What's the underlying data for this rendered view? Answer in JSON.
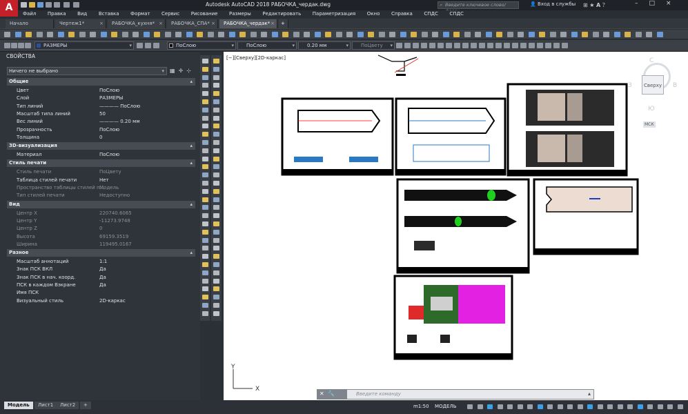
{
  "app": {
    "logo_text": "A",
    "title": "Autodesk AutoCAD 2018    РАБОЧКА_чердак.dwg",
    "search_placeholder": "Введите ключевое слово/фразу",
    "sign_in": "Вход в службы"
  },
  "menu": [
    "Файл",
    "Правка",
    "Вид",
    "Вставка",
    "Формат",
    "Сервис",
    "Рисование",
    "Размеры",
    "Редактировать",
    "Параметризация",
    "Окно",
    "Справка",
    "СПДС",
    "СПДС"
  ],
  "tabs": [
    {
      "label": "Начало",
      "close": ""
    },
    {
      "label": "Чертеж1*",
      "close": "×"
    },
    {
      "label": "РАБОЧКА_кухня*",
      "close": "×"
    },
    {
      "label": "РАБОЧКА_СПА*",
      "close": "×"
    },
    {
      "label": "РАБОЧКА_чердак*",
      "close": "×"
    }
  ],
  "toolbar2": {
    "layer": "РАЗМЕРЫ",
    "color": "ПоСлою",
    "linetype": "ПоСлою",
    "lineweight": "0.20 мм",
    "plotstyle": "ПоЦвету"
  },
  "palette": {
    "title": "СВОЙСТВА",
    "selector": "Ничего не выбрано",
    "sections": [
      {
        "name": "Общие",
        "rows": [
          {
            "k": "Цвет",
            "v": "ПоСлою",
            "dim": false
          },
          {
            "k": "Слой",
            "v": "РАЗМЕРЫ",
            "dim": false
          },
          {
            "k": "Тип линий",
            "v": "———— ПоСлою",
            "dim": false
          },
          {
            "k": "Масштаб типа линий",
            "v": "50",
            "dim": false
          },
          {
            "k": "Вес линий",
            "v": "———— 0.20 мм",
            "dim": false
          },
          {
            "k": "Прозрачность",
            "v": "ПоСлою",
            "dim": false
          },
          {
            "k": "Толщина",
            "v": "0",
            "dim": false
          }
        ]
      },
      {
        "name": "3D-визуализация",
        "rows": [
          {
            "k": "Материал",
            "v": "ПоСлою",
            "dim": false
          }
        ]
      },
      {
        "name": "Стиль печати",
        "rows": [
          {
            "k": "Стиль печати",
            "v": "ПоЦвету",
            "dim": true
          },
          {
            "k": "Таблица стилей печати",
            "v": "Нет",
            "dim": false
          },
          {
            "k": "Пространство таблицы стилей п...",
            "v": "Модель",
            "dim": true
          },
          {
            "k": "Тип стилей печати",
            "v": "Недоступно",
            "dim": true
          }
        ]
      },
      {
        "name": "Вид",
        "rows": [
          {
            "k": "Центр X",
            "v": "220740.6065",
            "dim": true
          },
          {
            "k": "Центр Y",
            "v": "-11273.9748",
            "dim": true
          },
          {
            "k": "Центр Z",
            "v": "0",
            "dim": true
          },
          {
            "k": "Высота",
            "v": "69159.3519",
            "dim": true
          },
          {
            "k": "Ширина",
            "v": "119495.0167",
            "dim": true
          }
        ]
      },
      {
        "name": "Разное",
        "rows": [
          {
            "k": "Масштаб аннотаций",
            "v": "1:1",
            "dim": false
          },
          {
            "k": "Знак ПСК ВКЛ",
            "v": "Да",
            "dim": false
          },
          {
            "k": "Знак ПСК в нач. коорд.",
            "v": "Да",
            "dim": false
          },
          {
            "k": "ПСК в каждом Вэкране",
            "v": "Да",
            "dim": false
          },
          {
            "k": "Имя ПСК",
            "v": "",
            "dim": false
          },
          {
            "k": "Визуальный стиль",
            "v": "2D-каркас",
            "dim": false
          }
        ]
      }
    ]
  },
  "viewport": {
    "label": "[−][Сверху][2D-каркас]"
  },
  "viewcube": {
    "north": "С",
    "south": "Ю",
    "east": "В",
    "west": "З",
    "face": "Сверху",
    "ucs": "МСК"
  },
  "ucs_axes": {
    "x": "X",
    "y": "Y"
  },
  "command": {
    "placeholder": "Введите  команду"
  },
  "layouts": [
    "Модель",
    "Лист1",
    "Лист2"
  ],
  "layout_add": "+",
  "status": {
    "scale": "m1:50",
    "space": "МОДЕЛЬ"
  },
  "colors": {
    "accent": "#c4202a",
    "palette_bg": "#2f333a",
    "canvas": "#ffffff"
  }
}
